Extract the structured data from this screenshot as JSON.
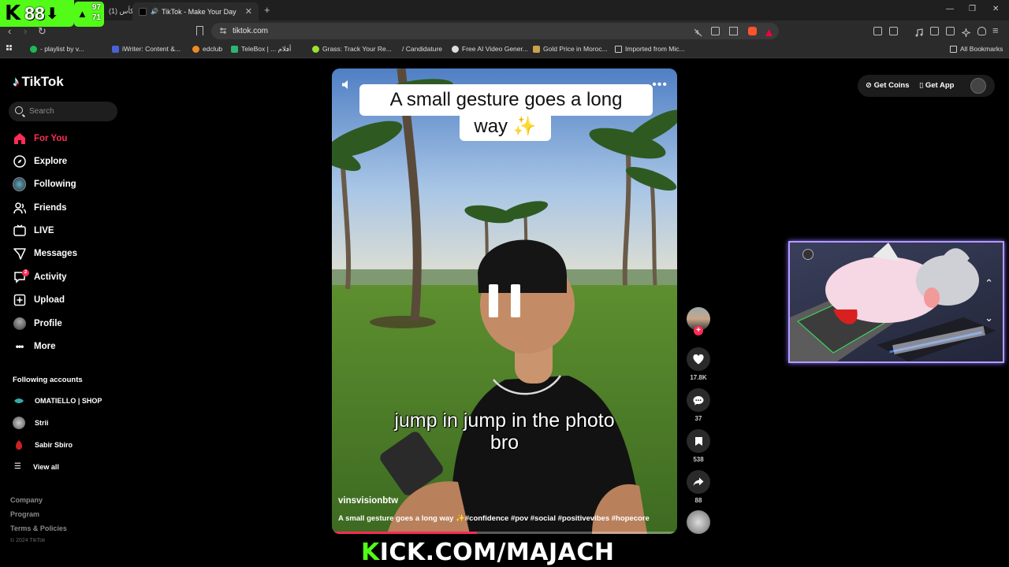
{
  "browser": {
    "tabs": [
      {
        "label": "(1) الكأس"
      },
      {
        "label": "TikTok - Make Your Day"
      }
    ],
    "url": "tiktok.com",
    "bookmarks": [
      "- playlist by v...",
      "iWriter: Content &...",
      "edclub",
      "TeleBox | ... أفلام",
      "Grass: Track Your Re...",
      "/ Candidature",
      "Free AI Video Gener...",
      "Gold Price in Moroc...",
      "Imported from Mic...",
      "All Bookmarks"
    ]
  },
  "overlay": {
    "viewer_count": "88",
    "stat1": "97",
    "stat2": "71",
    "kick_url_first": "K",
    "kick_url_rest": "ICK.COM/MAJACH",
    "brand_color": "#53fc18"
  },
  "sidebar": {
    "logo": "TikTok",
    "search_placeholder": "Search",
    "nav": [
      {
        "label": "For You",
        "icon": "home-icon"
      },
      {
        "label": "Explore",
        "icon": "compass-icon"
      },
      {
        "label": "Following",
        "icon": "following-avatar-icon"
      },
      {
        "label": "Friends",
        "icon": "friends-icon"
      },
      {
        "label": "LIVE",
        "icon": "live-icon"
      },
      {
        "label": "Messages",
        "icon": "messages-icon"
      },
      {
        "label": "Activity",
        "icon": "activity-icon",
        "badge": "2"
      },
      {
        "label": "Upload",
        "icon": "upload-icon"
      },
      {
        "label": "Profile",
        "icon": "profile-avatar-icon"
      },
      {
        "label": "More",
        "icon": "more-icon"
      }
    ],
    "following_title": "Following accounts",
    "following": [
      "OMATIELLO | SHOP",
      "Strii",
      "Sabir Sbiro"
    ],
    "view_all": "View all",
    "footer": [
      "Company",
      "Program",
      "Terms & Policies"
    ],
    "copyright": "© 2024 TikTok"
  },
  "video": {
    "caption_line1": "A small gesture goes a long",
    "caption_line2": "way ✨",
    "subtitle_line1": "jump in jump in the photo",
    "subtitle_line2": "bro",
    "author": "vinsvisionbtw",
    "description": "A small gesture goes a long way ✨#confidence #pov #social #positivevibes #hopecore",
    "progress": 0.42
  },
  "actions": {
    "likes": "17.8K",
    "comments": "37",
    "saves": "538",
    "shares": "88"
  },
  "topbar": {
    "get_coins": "Get Coins",
    "get_app": "Get App"
  },
  "colors": {
    "accent": "#fe2c55",
    "background": "#000000"
  }
}
